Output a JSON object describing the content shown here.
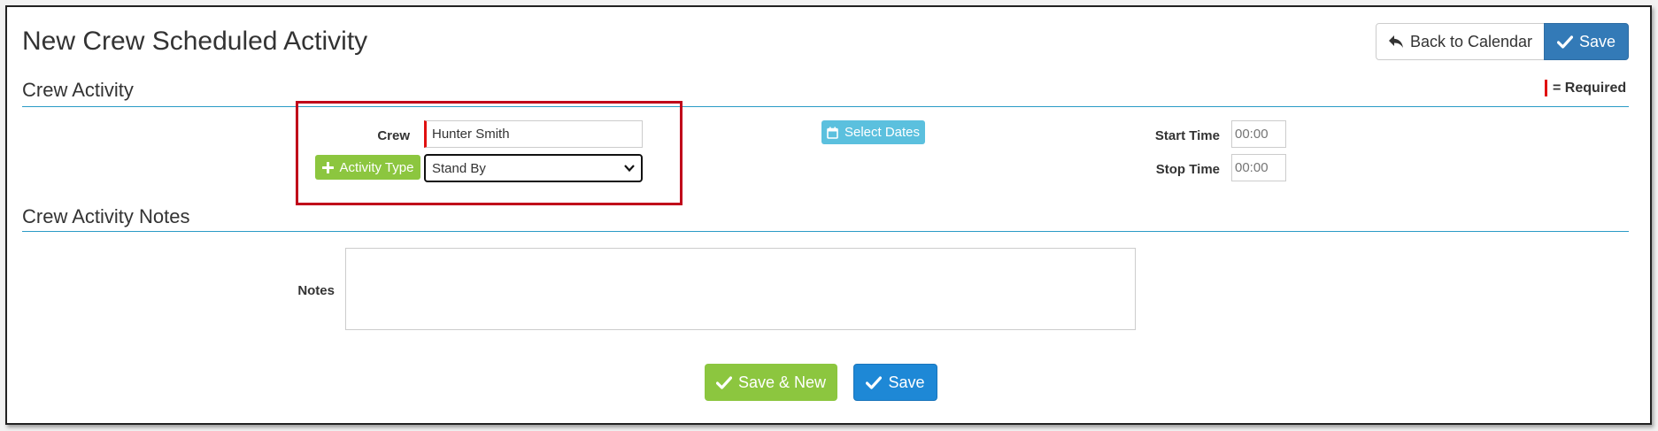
{
  "page": {
    "title": "New Crew Scheduled Activity"
  },
  "header": {
    "back_label": "Back to Calendar",
    "save_label": "Save"
  },
  "crew_activity": {
    "section_title": "Crew Activity",
    "required_legend": "= Required",
    "crew_label": "Crew",
    "crew_value": "Hunter Smith",
    "activity_type_button": "Activity Type",
    "activity_type_value": "Stand By",
    "select_dates_button": "Select Dates",
    "start_time_label": "Start Time",
    "start_time_placeholder": "00:00",
    "stop_time_label": "Stop Time",
    "stop_time_placeholder": "00:00"
  },
  "notes": {
    "section_title": "Crew Activity Notes",
    "notes_label": "Notes",
    "notes_value": ""
  },
  "footer": {
    "save_new_label": "Save & New",
    "save_label": "Save"
  },
  "colors": {
    "primary": "#337ab7",
    "success": "#8cc63f",
    "info": "#5bc0de",
    "required": "#e01010",
    "highlight": "#c0001a",
    "rule": "#2b9bc6"
  },
  "icons": {
    "back": "reply-arrow-icon",
    "save": "check-icon",
    "add": "plus-icon",
    "calendar": "calendar-icon",
    "dropdown": "chevron-down-icon"
  }
}
